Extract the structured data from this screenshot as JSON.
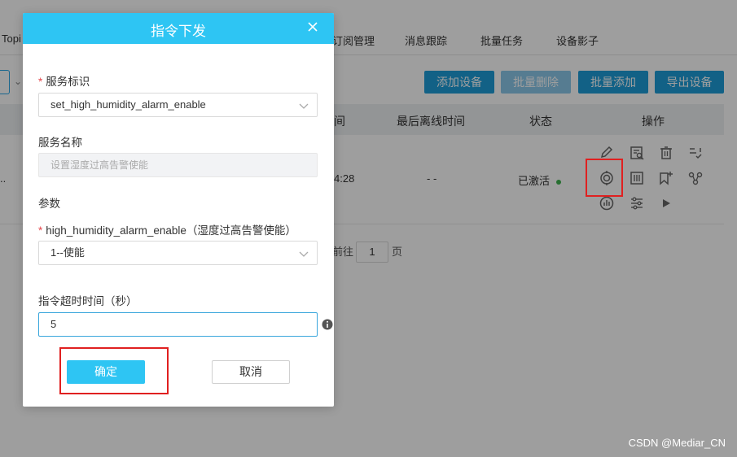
{
  "background": {
    "tabs": [
      "Topi",
      "订阅管理",
      "消息跟踪",
      "批量任务",
      "设备影子"
    ],
    "toolbar": {
      "add_device": "添加设备",
      "batch_delete": "批量删除",
      "batch_add": "批量添加",
      "export_devices": "导出设备"
    },
    "table": {
      "headers": [
        "间",
        "最后离线时间",
        "状态",
        "操作"
      ],
      "row": {
        "left_ellipsis": "..",
        "time_fragment": "4:28",
        "last_offline": "- -",
        "status": "已激活"
      },
      "operation_icons": [
        "edit-icon",
        "detail-icon",
        "delete-icon",
        "checklist-icon",
        "command-icon",
        "debug-icon",
        "tag-add-icon",
        "topology-icon",
        "chart-icon",
        "settings-icon",
        "play-icon"
      ]
    },
    "pager": {
      "goto_prefix": "前往",
      "page_value": "1",
      "page_suffix": "页"
    }
  },
  "dialog": {
    "title": "指令下发",
    "service_id_label": "服务标识",
    "service_id_value": "set_high_humidity_alarm_enable",
    "service_name_label": "服务名称",
    "service_name_placeholder": "设置湿度过高告警使能",
    "params_label": "参数",
    "param_label": "high_humidity_alarm_enable（湿度过高告警使能）",
    "param_value": "1--使能",
    "timeout_label": "指令超时时间（秒）",
    "timeout_value": "5",
    "ok_label": "确定",
    "cancel_label": "取消"
  },
  "watermark": "CSDN @Mediar_CN",
  "colors": {
    "dialog_header": "#2ec5f3",
    "primary_button": "#1e9dd8",
    "highlight_box": "#e02020",
    "status_dot": "#3fb34f"
  }
}
